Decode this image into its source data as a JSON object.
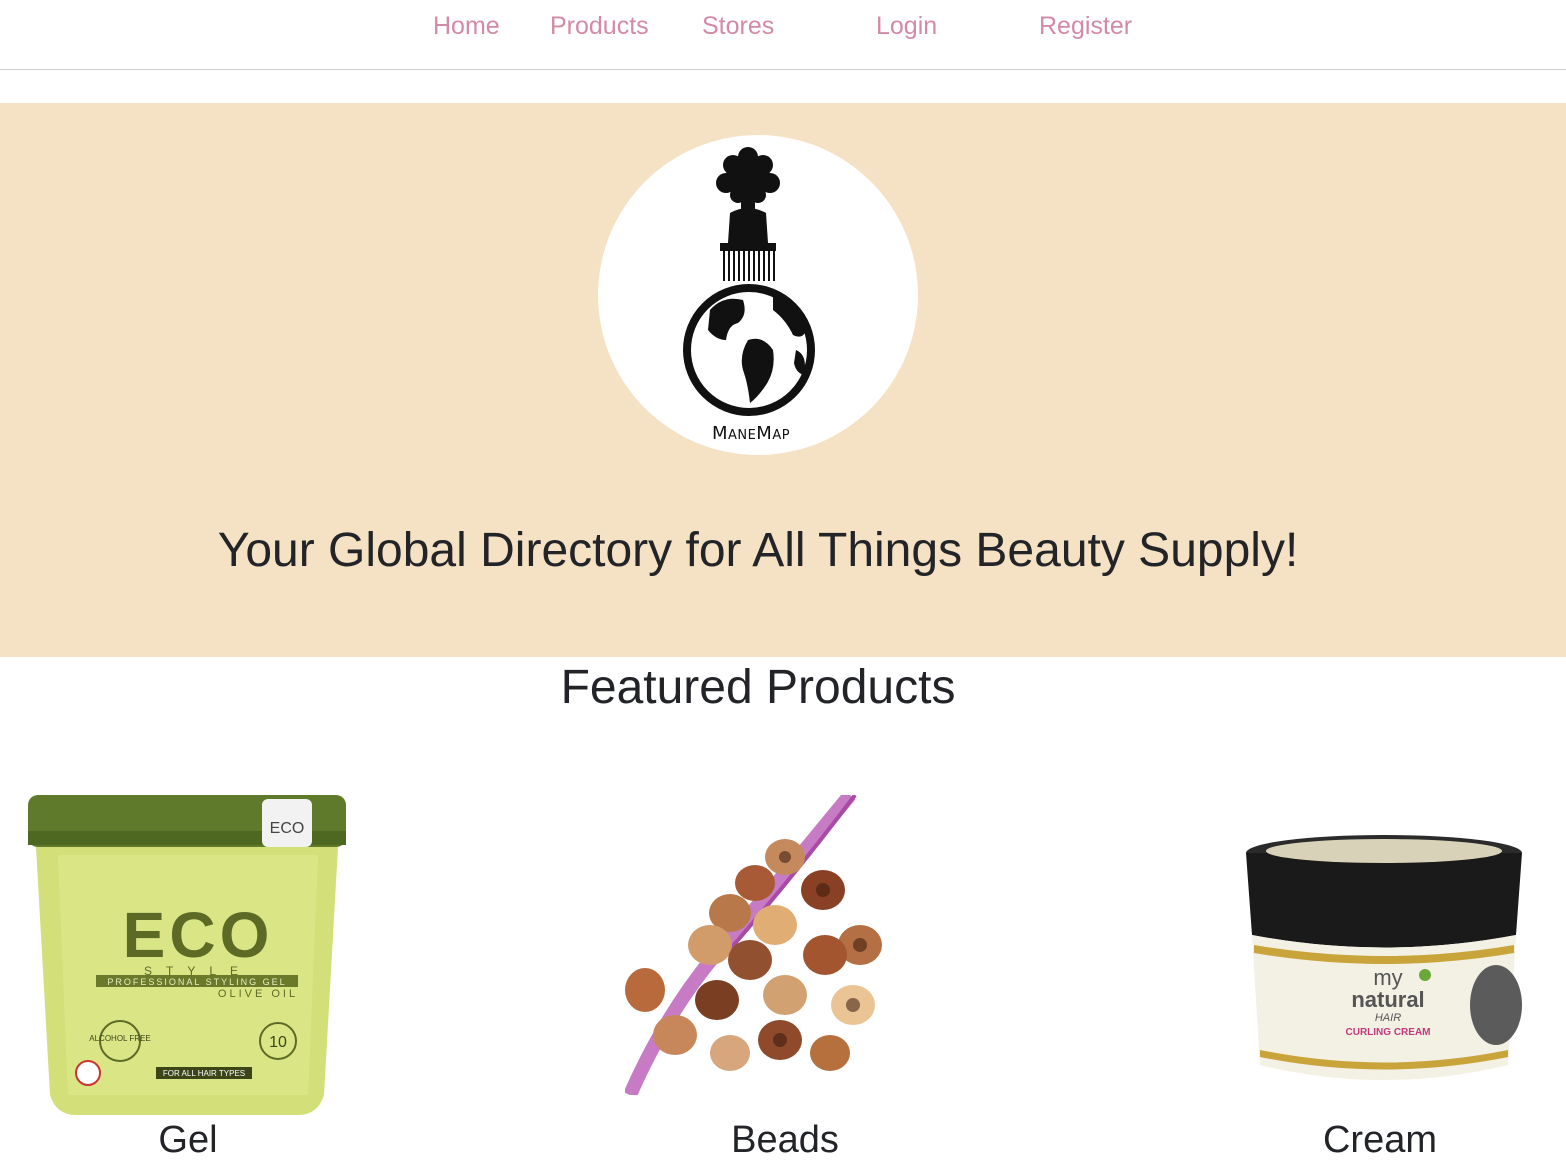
{
  "nav": {
    "links": [
      {
        "label": "Home"
      },
      {
        "label": "Products"
      },
      {
        "label": "Stores"
      },
      {
        "label": "Login"
      },
      {
        "label": "Register"
      }
    ]
  },
  "hero": {
    "logo_text": "ManeMap",
    "tagline": "Your Global Directory for All Things Beauty Supply!",
    "background": "#f5e1c3"
  },
  "featured": {
    "title": "Featured Products",
    "products": [
      {
        "name": "Gel",
        "image_alt": "Eco Style Olive Oil gel tub"
      },
      {
        "name": "Beads",
        "image_alt": "Wooden hair beads"
      },
      {
        "name": "Cream",
        "image_alt": "My Natural Hair curling cream jar"
      }
    ],
    "gel_label": {
      "brand": "ECO",
      "style": "STYLE",
      "sub": "PROFESSIONAL STYLING GEL",
      "variant": "OLIVE OIL",
      "badge_left": "ALCOHOL FREE",
      "badge_right": "10",
      "band": "FOR ALL HAIR TYPES"
    },
    "cream_label": {
      "brand_top": "my",
      "brand_mid": "natural",
      "brand_sub": "HAIR",
      "product": "CURLING CREAM"
    }
  },
  "colors": {
    "nav_link": "#d38aa6",
    "text": "#222428"
  }
}
